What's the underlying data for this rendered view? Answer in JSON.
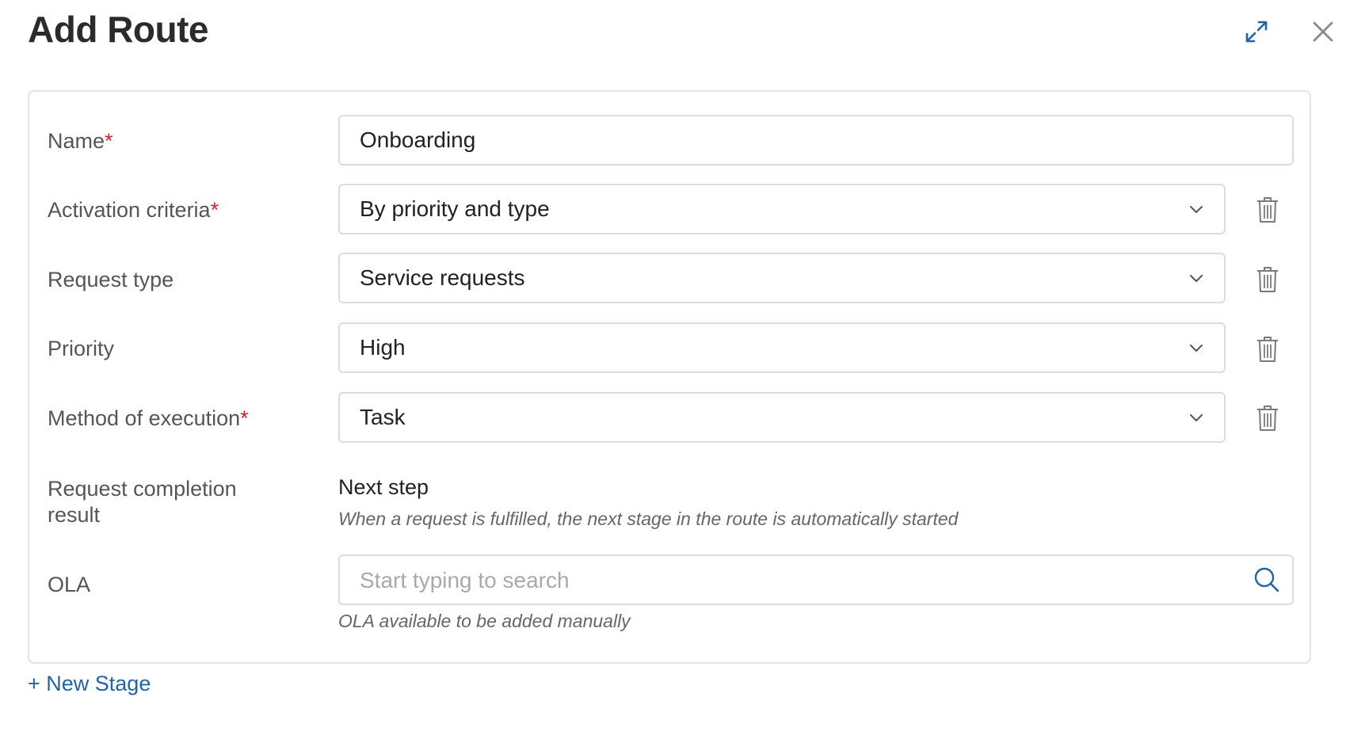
{
  "dialog": {
    "title": "Add Route"
  },
  "form": {
    "name": {
      "label": "Name",
      "required_mark": "*",
      "value": "Onboarding"
    },
    "activation_criteria": {
      "label": "Activation criteria",
      "required_mark": "*",
      "value": "By priority and type"
    },
    "request_type": {
      "label": "Request type",
      "value": "Service requests"
    },
    "priority": {
      "label": "Priority",
      "value": "High"
    },
    "method_of_execution": {
      "label": "Method of execution",
      "required_mark": "*",
      "value": "Task"
    },
    "request_completion_result": {
      "label_line1": "Request completion",
      "label_line2": "result",
      "value": "Next step",
      "hint": "When a request is fulfilled, the next stage in the route is automatically started"
    },
    "ola": {
      "label": "OLA",
      "placeholder": "Start typing to search",
      "hint": "OLA available to be added manually"
    }
  },
  "actions": {
    "new_stage": "+ New Stage"
  },
  "icons": {
    "expand": "expand-icon",
    "close": "close-icon",
    "chevron": "chevron-down-icon",
    "trash": "trash-icon",
    "search": "search-icon"
  },
  "colors": {
    "required": "#d6202c",
    "accent": "#1f63a8",
    "border": "#dcdcdc"
  }
}
